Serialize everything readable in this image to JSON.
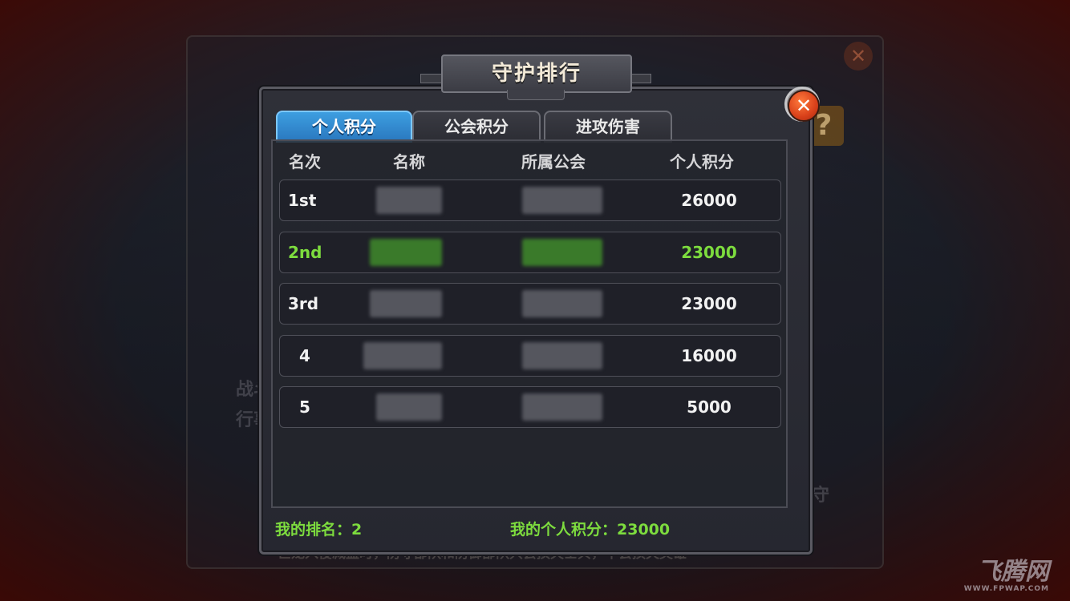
{
  "window": {
    "title": "守护排行"
  },
  "tabs": [
    {
      "label": "个人积分",
      "active": true
    },
    {
      "label": "公会积分",
      "active": false
    },
    {
      "label": "进攻伤害",
      "active": false
    }
  ],
  "table": {
    "headers": {
      "rank": "名次",
      "name": "名称",
      "guild": "所属公会",
      "score": "个人积分"
    },
    "rows": [
      {
        "rank": "1st",
        "score": "26000",
        "highlight": false
      },
      {
        "rank": "2nd",
        "score": "23000",
        "highlight": true
      },
      {
        "rank": "3rd",
        "score": "23000",
        "highlight": false
      },
      {
        "rank": "4",
        "score": "16000",
        "highlight": false
      },
      {
        "rank": "5",
        "score": "5000",
        "highlight": false
      }
    ]
  },
  "footer": {
    "my_rank": "我的排名：2",
    "my_score": "我的个人积分：23000"
  },
  "background": {
    "side_texts": [
      "战斗",
      "行事"
    ],
    "right_text": "守",
    "bottom_text": "巨龙入侵减益时，防守部队和防御部队只会损失士兵，不会损失英雄",
    "help_icon": "?"
  },
  "watermark": {
    "logo": "飞腾网",
    "url": "WWW.FPWAP.COM"
  },
  "colors": {
    "highlight": "#7ddc3e",
    "tab_active": "#2a78bf",
    "close": "#d8401a"
  }
}
